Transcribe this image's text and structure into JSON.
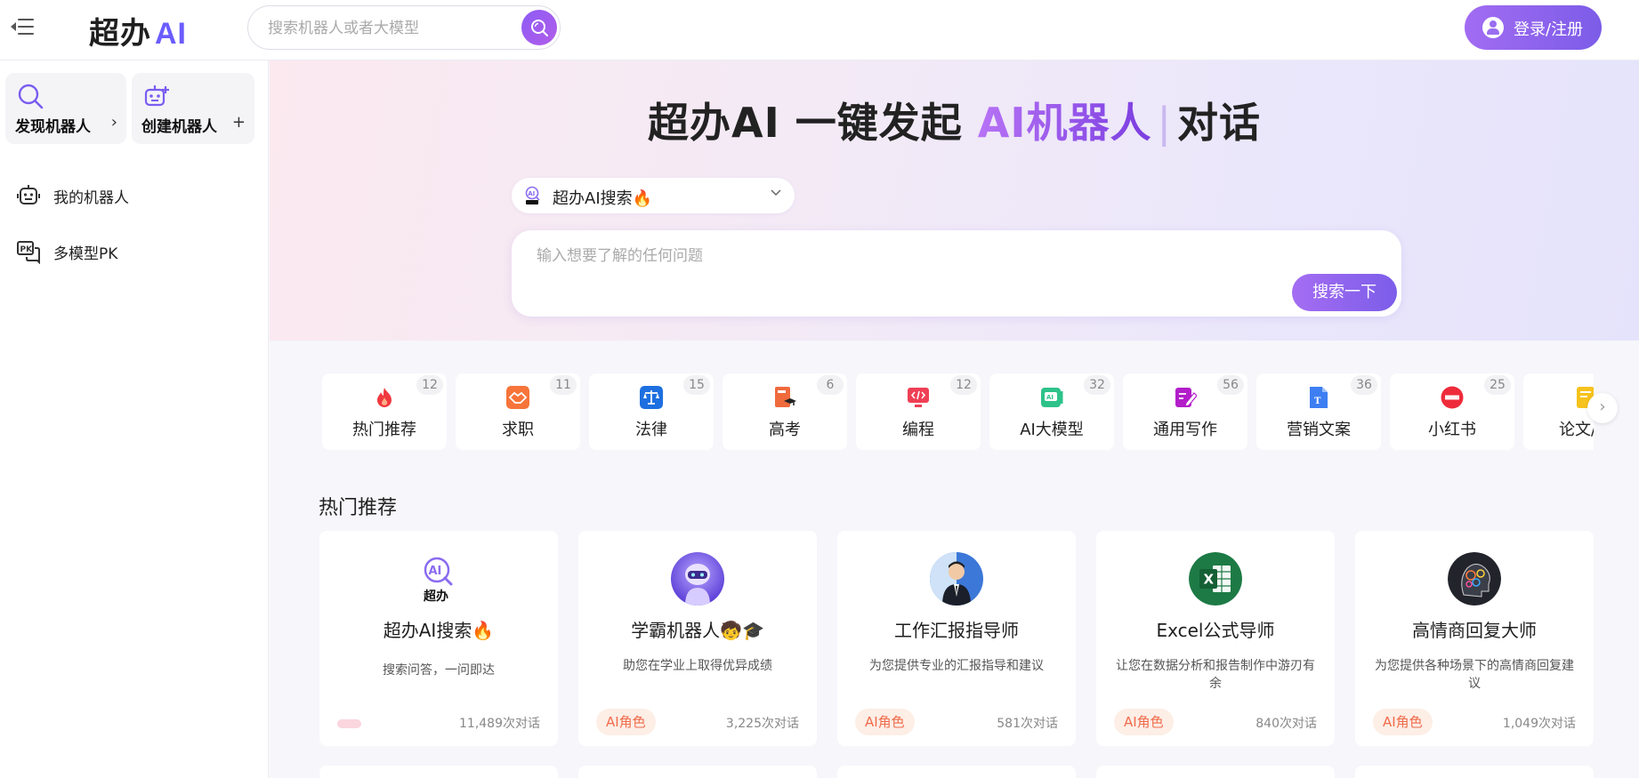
{
  "header": {
    "logo_text": "超办",
    "logo_ai": "AI",
    "search_placeholder": "搜索机器人或者大模型",
    "login_label": "登录/注册"
  },
  "sidebar": {
    "discover_label": "发现机器人",
    "discover_trail": "›",
    "create_label": "创建机器人",
    "create_trail": "+",
    "items": [
      {
        "label": "我的机器人",
        "icon": "robot-icon"
      },
      {
        "label": "多模型PK",
        "icon": "pk-icon"
      }
    ]
  },
  "hero": {
    "title_prefix": "超办AI 一键发起 ",
    "title_highlight": "AI机器人",
    "title_cursor": "|",
    "title_suffix": "对话",
    "model_selected": "超办AI搜索🔥",
    "ask_placeholder": "输入想要了解的任何问题",
    "ask_button": "搜索一下"
  },
  "categories": [
    {
      "label": "热门推荐",
      "count": "12",
      "icon": "fire-icon",
      "color": "#f0393f"
    },
    {
      "label": "求职",
      "count": "11",
      "icon": "handshake-icon",
      "color": "#f7743a"
    },
    {
      "label": "法律",
      "count": "15",
      "icon": "scale-icon",
      "color": "#1e6fe0"
    },
    {
      "label": "高考",
      "count": "6",
      "icon": "exam-book-icon",
      "color": "#ef6a3d"
    },
    {
      "label": "编程",
      "count": "12",
      "icon": "code-icon",
      "color": "#ef3f55"
    },
    {
      "label": "AI大模型",
      "count": "32",
      "icon": "ai-model-icon",
      "color": "#2ec28b"
    },
    {
      "label": "通用写作",
      "count": "56",
      "icon": "writing-icon",
      "color": "#b21ec9"
    },
    {
      "label": "营销文案",
      "count": "36",
      "icon": "document-icon",
      "color": "#3d7ef2"
    },
    {
      "label": "小红书",
      "count": "25",
      "icon": "xiaohongshu-icon",
      "color": "#ee2b3b"
    },
    {
      "label": "论文/论",
      "count": "",
      "icon": "paper-icon",
      "color": "#f6c21c"
    }
  ],
  "section_title": "热门推荐",
  "bots": [
    {
      "name": "超办AI搜索🔥",
      "desc": "搜索问答，一问即达",
      "tag": "",
      "chats": "11,489次对话",
      "avatar": "chaoban-ai-logo"
    },
    {
      "name": "学霸机器人🧒🎓",
      "desc": "助您在学业上取得优异成绩",
      "tag": "AI角色",
      "chats": "3,225次对话",
      "avatar": "robot-avatar"
    },
    {
      "name": "工作汇报指导师",
      "desc": "为您提供专业的汇报指导和建议",
      "tag": "AI角色",
      "chats": "581次对话",
      "avatar": "businessman-avatar"
    },
    {
      "name": "Excel公式导师",
      "desc": "让您在数据分析和报告制作中游刃有余",
      "tag": "AI角色",
      "chats": "840次对话",
      "avatar": "excel-icon"
    },
    {
      "name": "高情商回复大师",
      "desc": "为您提供各种场景下的高情商回复建议",
      "tag": "AI角色",
      "chats": "1,049次对话",
      "avatar": "brain-avatar"
    }
  ],
  "colors": {
    "accent": "#8d5cf6",
    "tag_text": "#f06b4a",
    "tag_bg": "#fdeee6"
  }
}
